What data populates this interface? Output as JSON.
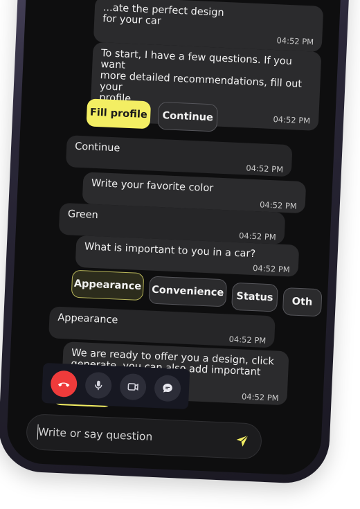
{
  "messages": {
    "m1": {
      "text": "...ate the perfect design\nfor your car",
      "time": "04:52 PM"
    },
    "m2": {
      "text": "To start, I have a few questions. If you want\nmore detailed recommendations, fill out your\nprofile",
      "time": "04:52 PM"
    },
    "m3": {
      "text": "Continue",
      "time": "04:52 PM"
    },
    "m4": {
      "text": "Write your favorite color",
      "time": "04:52 PM"
    },
    "m5": {
      "text": "Green",
      "time": "04:52 PM"
    },
    "m6": {
      "text": "What is important to you in a car?",
      "time": "04:52 PM"
    },
    "m7": {
      "text": "Appearance",
      "time": "04:52 PM"
    },
    "m8": {
      "text": "We are ready to offer you a design, click\ngenerate, you can also add important\n...nces",
      "time": "04:52 PM"
    }
  },
  "chips": {
    "fill_profile": "Fill profile",
    "continue": "Continue",
    "appearance": "Appearance",
    "convenience": "Convenience",
    "status": "Status",
    "other": "Oth"
  },
  "input": {
    "placeholder": "Write or say question"
  },
  "icons": {
    "hangup": "phone-hangup-icon",
    "mic": "microphone-icon",
    "video": "video-icon",
    "chat": "chat-bubble-icon",
    "send": "send-icon"
  },
  "colors": {
    "accent": "#f3ee63",
    "hangup": "#ef3b3b",
    "screen_bg": "#0e0e0f",
    "bubble_bg": "#2b2b2d"
  }
}
